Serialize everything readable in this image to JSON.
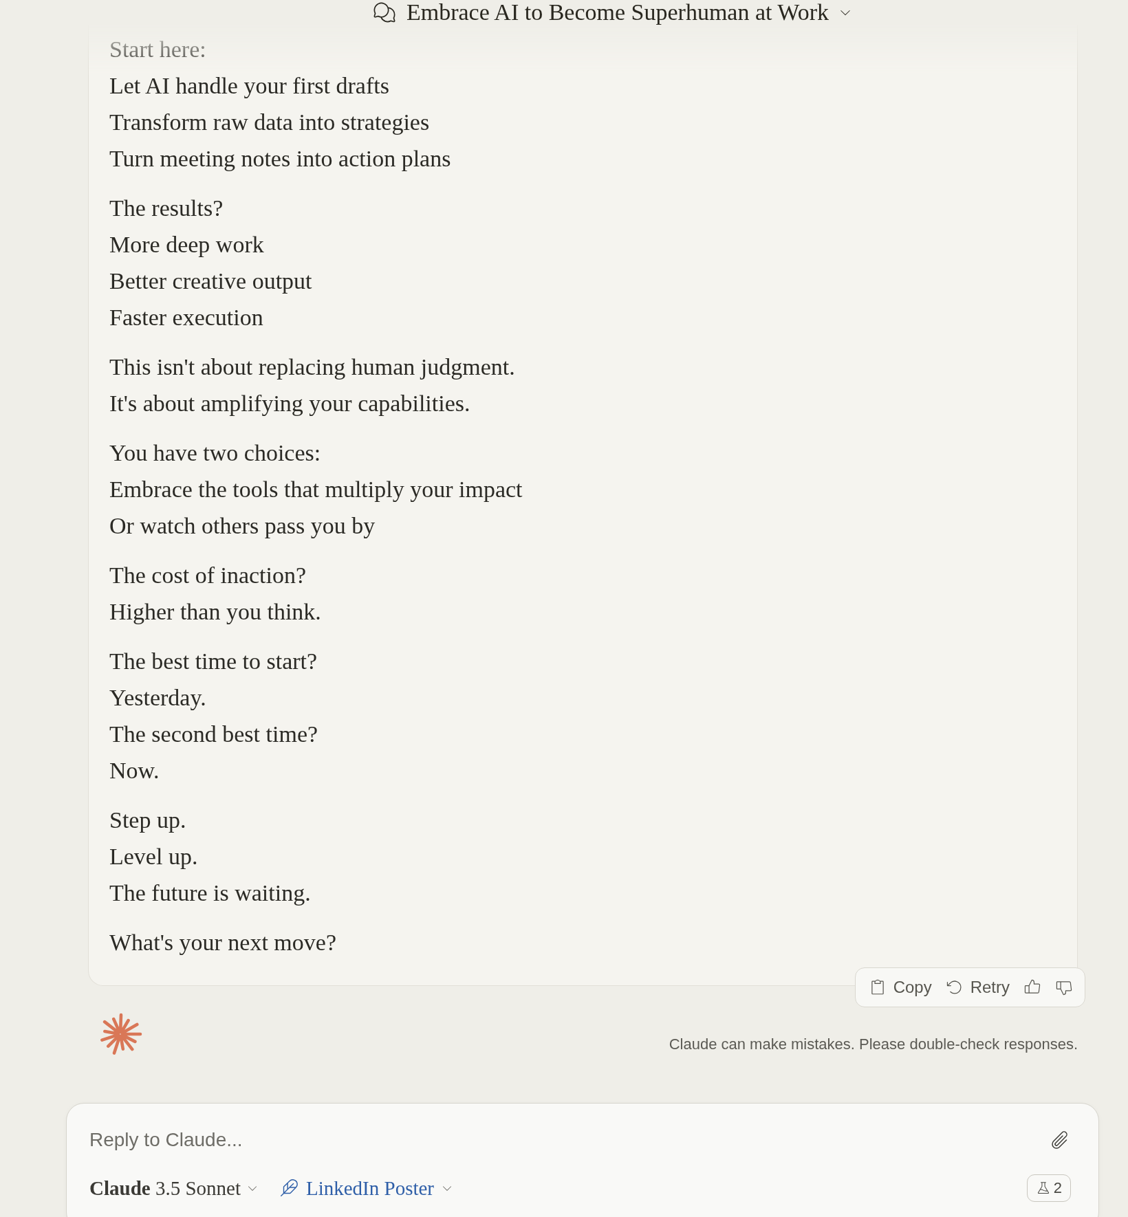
{
  "header": {
    "title": "Embrace AI to Become Superhuman at Work"
  },
  "message": {
    "paragraphs": [
      {
        "lines": [
          "Start here:",
          "Let AI handle your first drafts",
          "Transform raw data into strategies",
          "Turn meeting notes into action plans"
        ]
      },
      {
        "lines": [
          "The results?",
          "More deep work",
          "Better creative output",
          "Faster execution"
        ]
      },
      {
        "lines": [
          "This isn't about replacing human judgment.",
          "It's about amplifying your capabilities."
        ]
      },
      {
        "lines": [
          "You have two choices:",
          "Embrace the tools that multiply your impact",
          "Or watch others pass you by"
        ]
      },
      {
        "lines": [
          "The cost of inaction?",
          "Higher than you think."
        ]
      },
      {
        "lines": [
          "The best time to start?",
          "Yesterday.",
          "The second best time?",
          "Now."
        ]
      },
      {
        "lines": [
          "Step up.",
          "Level up.",
          "The future is waiting."
        ]
      },
      {
        "lines": [
          "What's your next move?"
        ]
      }
    ]
  },
  "actions": [
    {
      "kind": "copy",
      "label": "Copy"
    },
    {
      "kind": "retry",
      "label": "Retry"
    },
    {
      "kind": "thumbs_up"
    },
    {
      "kind": "thumbs_down"
    }
  ],
  "disclaimer": "Claude can make mistakes. Please double-check responses.",
  "composer": {
    "placeholder": "Reply to Claude...",
    "model": {
      "label": "**Claude** 3.5 Sonnet"
    },
    "style": {
      "label": "LinkedIn Poster"
    },
    "badge": {
      "count": "2"
    }
  }
}
